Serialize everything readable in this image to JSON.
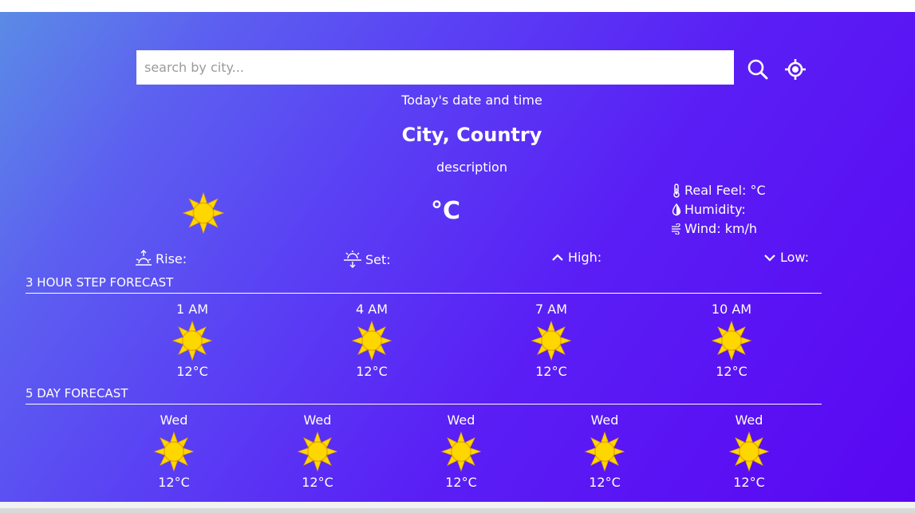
{
  "search": {
    "placeholder": "search by city..."
  },
  "current": {
    "date_time": "Today's date and time",
    "location": "City, Country",
    "description": "description",
    "temperature": "°C",
    "weather_icon": "sun-icon"
  },
  "details": {
    "real_feel": "Real Feel: °C",
    "humidity": "Humidity:",
    "wind": "Wind: km/h"
  },
  "sun_row": {
    "rise": "Rise:",
    "set": "Set:",
    "high": "High:",
    "low": "Low:"
  },
  "hourly": {
    "title": "3 HOUR STEP FORECAST",
    "items": [
      {
        "time": "1 AM",
        "temp": "12°C",
        "icon": "sun-icon"
      },
      {
        "time": "4 AM",
        "temp": "12°C",
        "icon": "sun-icon"
      },
      {
        "time": "7 AM",
        "temp": "12°C",
        "icon": "sun-icon"
      },
      {
        "time": "10 AM",
        "temp": "12°C",
        "icon": "sun-icon"
      }
    ]
  },
  "daily": {
    "title": "5 DAY FORECAST",
    "items": [
      {
        "time": "Wed",
        "temp": "12°C",
        "icon": "sun-icon"
      },
      {
        "time": "Wed",
        "temp": "12°C",
        "icon": "sun-icon"
      },
      {
        "time": "Wed",
        "temp": "12°C",
        "icon": "sun-icon"
      },
      {
        "time": "Wed",
        "temp": "12°C",
        "icon": "sun-icon"
      },
      {
        "time": "Wed",
        "temp": "12°C",
        "icon": "sun-icon"
      }
    ]
  },
  "colors": {
    "sun_fill": "#ffd700",
    "sun_stroke": "#e6a800",
    "gradient_start": "#5b8be6",
    "gradient_end": "#5a06f2"
  }
}
